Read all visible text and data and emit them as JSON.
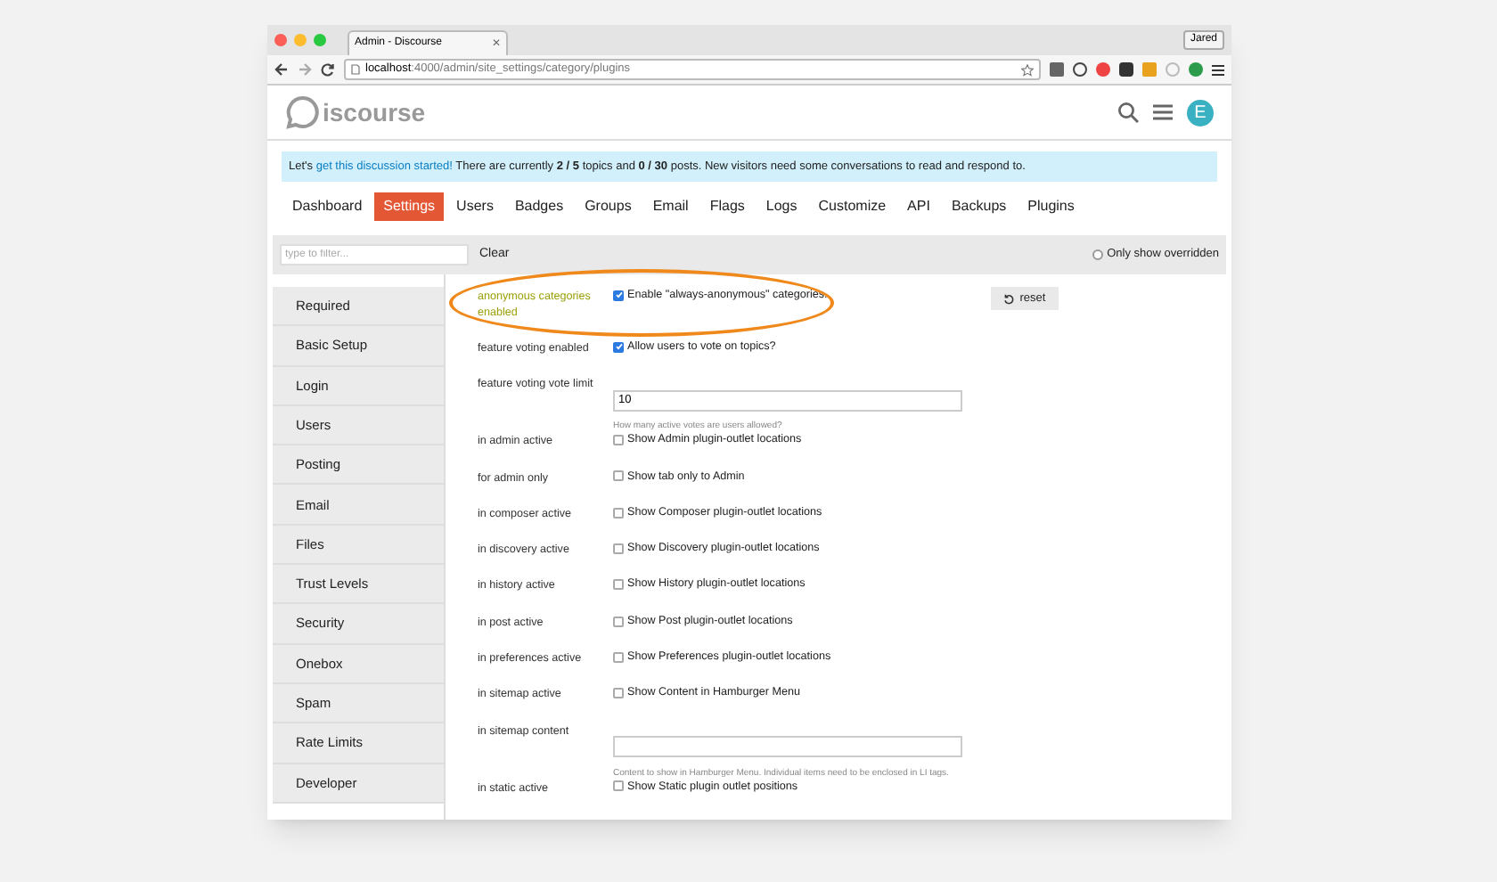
{
  "browser": {
    "tab_title": "Admin - Discourse",
    "profile": "Jared",
    "url_host": "localhost",
    "url_path": ":4000/admin/site_settings/category/plugins"
  },
  "tab_close": "✕",
  "logo_text": "iscourse",
  "banner_parts": {
    "before": "Let's ",
    "link": "get this discussion started!",
    "after": " There are currently **2 / 5** topics and **0 / 30** posts. New visitors need some conversations to read and respond to."
  },
  "avatar_letter": "E",
  "nav_tabs": [
    {
      "label": "Dashboard",
      "selected": false
    },
    {
      "label": "Settings",
      "selected": true
    },
    {
      "label": "Users",
      "selected": false
    },
    {
      "label": "Badges",
      "selected": false
    },
    {
      "label": "Groups",
      "selected": false
    },
    {
      "label": "Email",
      "selected": false
    },
    {
      "label": "Flags",
      "selected": false
    },
    {
      "label": "Logs",
      "selected": false
    },
    {
      "label": "Customize",
      "selected": false
    },
    {
      "label": "API",
      "selected": false
    },
    {
      "label": "Backups",
      "selected": false
    },
    {
      "label": "Plugins",
      "selected": false
    }
  ],
  "filter": {
    "placeholder": "type to filter...",
    "clear": "Clear",
    "only_overridden": "Only show overridden",
    "only_overridden_checked": false
  },
  "sidebar": [
    {
      "label": "Required"
    },
    {
      "label": "Basic Setup"
    },
    {
      "label": "Login"
    },
    {
      "label": "Users"
    },
    {
      "label": "Posting"
    },
    {
      "label": "Email"
    },
    {
      "label": "Files"
    },
    {
      "label": "Trust Levels"
    },
    {
      "label": "Security"
    },
    {
      "label": "Onebox"
    },
    {
      "label": "Spam"
    },
    {
      "label": "Rate Limits"
    },
    {
      "label": "Developer"
    }
  ],
  "settings": [
    {
      "kind": "checkbox",
      "label": "anonymous categories enabled",
      "text": "Enable \"always-anonymous\" categories.",
      "checked": true,
      "overridden": true,
      "circled": true,
      "reset": "reset"
    },
    {
      "kind": "checkbox",
      "label": "feature voting enabled",
      "text": "Allow users to vote on topics?",
      "checked": true,
      "overridden": false,
      "circled": false
    },
    {
      "kind": "input",
      "label": "feature voting vote limit",
      "value": "10",
      "help": "How many active votes are users allowed?",
      "overridden": false,
      "circled": false
    },
    {
      "kind": "checkbox",
      "label": "in admin active",
      "text": "Show Admin plugin-outlet locations",
      "checked": false,
      "overridden": false,
      "circled": false
    },
    {
      "kind": "checkbox",
      "label": "for admin only",
      "text": "Show tab only to Admin",
      "checked": false,
      "overridden": false,
      "circled": false
    },
    {
      "kind": "checkbox",
      "label": "in composer active",
      "text": "Show Composer plugin-outlet locations",
      "checked": false,
      "overridden": false,
      "circled": false
    },
    {
      "kind": "checkbox",
      "label": "in discovery active",
      "text": "Show Discovery plugin-outlet locations",
      "checked": false,
      "overridden": false,
      "circled": false
    },
    {
      "kind": "checkbox",
      "label": "in history active",
      "text": "Show History plugin-outlet locations",
      "checked": false,
      "overridden": false,
      "circled": false
    },
    {
      "kind": "checkbox",
      "label": "in post active",
      "text": "Show Post plugin-outlet locations",
      "checked": false,
      "overridden": false,
      "circled": false
    },
    {
      "kind": "checkbox",
      "label": "in preferences active",
      "text": "Show Preferences plugin-outlet locations",
      "checked": false,
      "overridden": false,
      "circled": false
    },
    {
      "kind": "checkbox",
      "label": "in sitemap active",
      "text": "Show Content in Hamburger Menu",
      "checked": false,
      "overridden": false,
      "circled": false
    },
    {
      "kind": "input",
      "label": "in sitemap content",
      "help": "Content to show in Hamburger Menu. Individual items need to be enclosed in LI tags.",
      "overridden": false,
      "circled": false
    },
    {
      "kind": "checkbox",
      "label": "in static active",
      "text": "Show Static plugin outlet positions",
      "checked": false,
      "overridden": false,
      "circled": false
    }
  ]
}
